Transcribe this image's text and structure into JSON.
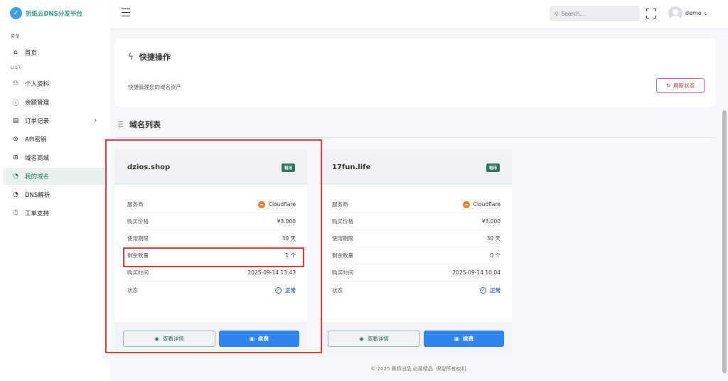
{
  "app": {
    "name": "折纸云DNS分发平台"
  },
  "sidebar": {
    "section_menu": "菜单",
    "section_list": "LIST",
    "home": {
      "label": "首页",
      "icon": "home-icon"
    },
    "items": [
      {
        "label": "个人资料",
        "icon": "users-icon"
      },
      {
        "label": "余额管理",
        "icon": "info-icon"
      },
      {
        "label": "订单记录",
        "icon": "file-icon"
      },
      {
        "label": "API密钥",
        "icon": "aperture-icon"
      },
      {
        "label": "域名商城",
        "icon": "layout-icon"
      },
      {
        "label": "我的域名",
        "icon": "pie-chart-icon",
        "active": true
      },
      {
        "label": "DNS解析",
        "icon": "pie-chart-icon"
      },
      {
        "label": "工单支持",
        "icon": "help-circle-icon"
      }
    ]
  },
  "header": {
    "search_placeholder": "Search...",
    "username": "demo"
  },
  "quick": {
    "title": "快捷操作",
    "desc": "快捷管理您的域名资产",
    "refresh_label": "刷新状态"
  },
  "domains_section": {
    "title": "域名列表"
  },
  "labels": {
    "provider": "服务商",
    "price": "购买价格",
    "period": "使用期限",
    "remaining": "剩余数量",
    "bought_at": "购买时间",
    "status": "状态",
    "detail_btn": "查看详情",
    "renew_btn": "续费"
  },
  "domains": [
    {
      "name": "dzios.shop",
      "badge": "租用",
      "provider": "Cloudflare",
      "price": "¥3.000",
      "period": "30 天",
      "remaining": "1 个",
      "bought_at": "2025-09-14 13:43",
      "status": "正常"
    },
    {
      "name": "17fun.life",
      "badge": "租用",
      "provider": "Cloudflare",
      "price": "¥3.000",
      "period": "30 天",
      "remaining": "0 个",
      "bought_at": "2025-09-14 10:04",
      "status": "正常"
    }
  ],
  "footer": "© 2025 赛桥出品 必属精品. 保留所有权利.",
  "colors": {
    "accent": "#1f7a5e",
    "primary_button": "#2f86ef",
    "highlight": "#e83a3a"
  }
}
